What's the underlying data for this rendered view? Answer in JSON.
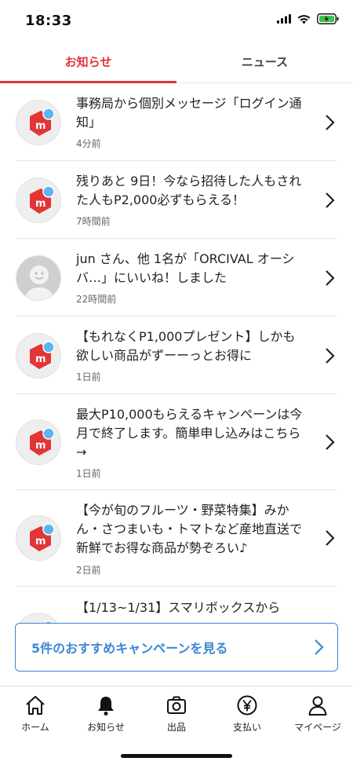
{
  "status": {
    "time": "18:33"
  },
  "tabs": [
    {
      "label": "お知らせ",
      "active": true
    },
    {
      "label": "ニュース",
      "active": false
    }
  ],
  "notifications": [
    {
      "text": "事務局から個別メッセージ「ログイン通知」",
      "time": "4分前",
      "avatar": "mercari-logo-icon",
      "unread": true
    },
    {
      "text": "残りあと 9日！今なら招待した人もされた人もP2,000必ずもらえる！",
      "time": "7時間前",
      "avatar": "mercari-logo-icon",
      "unread": true
    },
    {
      "text": "jun さん、他 1名が「ORCIVAL オーシバ…」にいいね！しました",
      "time": "22時間前",
      "avatar": "default-user-icon",
      "unread": false
    },
    {
      "text": "【もれなくP1,000プレゼント】しかも欲しい商品がずーーっとお得に",
      "time": "1日前",
      "avatar": "mercari-logo-icon",
      "unread": true
    },
    {
      "text": "最大P10,000もらえるキャンペーンは今月で終了します。簡単申し込みはこちら→",
      "time": "1日前",
      "avatar": "mercari-logo-icon",
      "unread": true
    },
    {
      "text": "【今が旬のフルーツ・野菜特集】みかん・さつまいも・トマトなど産地直送で新鮮でお得な商品が勢ぞろい♪",
      "time": "2日前",
      "avatar": "mercari-logo-icon",
      "unread": true
    },
    {
      "text": "【1/13~1/31】スマリボックスから",
      "time": "",
      "avatar": "mercari-logo-icon",
      "unread": true
    }
  ],
  "recommend": {
    "label": "5件のおすすめキャンペーンを見る"
  },
  "bottom_nav": [
    {
      "label": "ホーム",
      "icon": "home-icon"
    },
    {
      "label": "お知らせ",
      "icon": "bell-icon"
    },
    {
      "label": "出品",
      "icon": "camera-icon"
    },
    {
      "label": "支払い",
      "icon": "yen-icon"
    },
    {
      "label": "マイページ",
      "icon": "person-icon"
    }
  ],
  "colors": {
    "accent": "#e23535",
    "link": "#3b86d6",
    "unread_dot": "#5bb7f0"
  }
}
